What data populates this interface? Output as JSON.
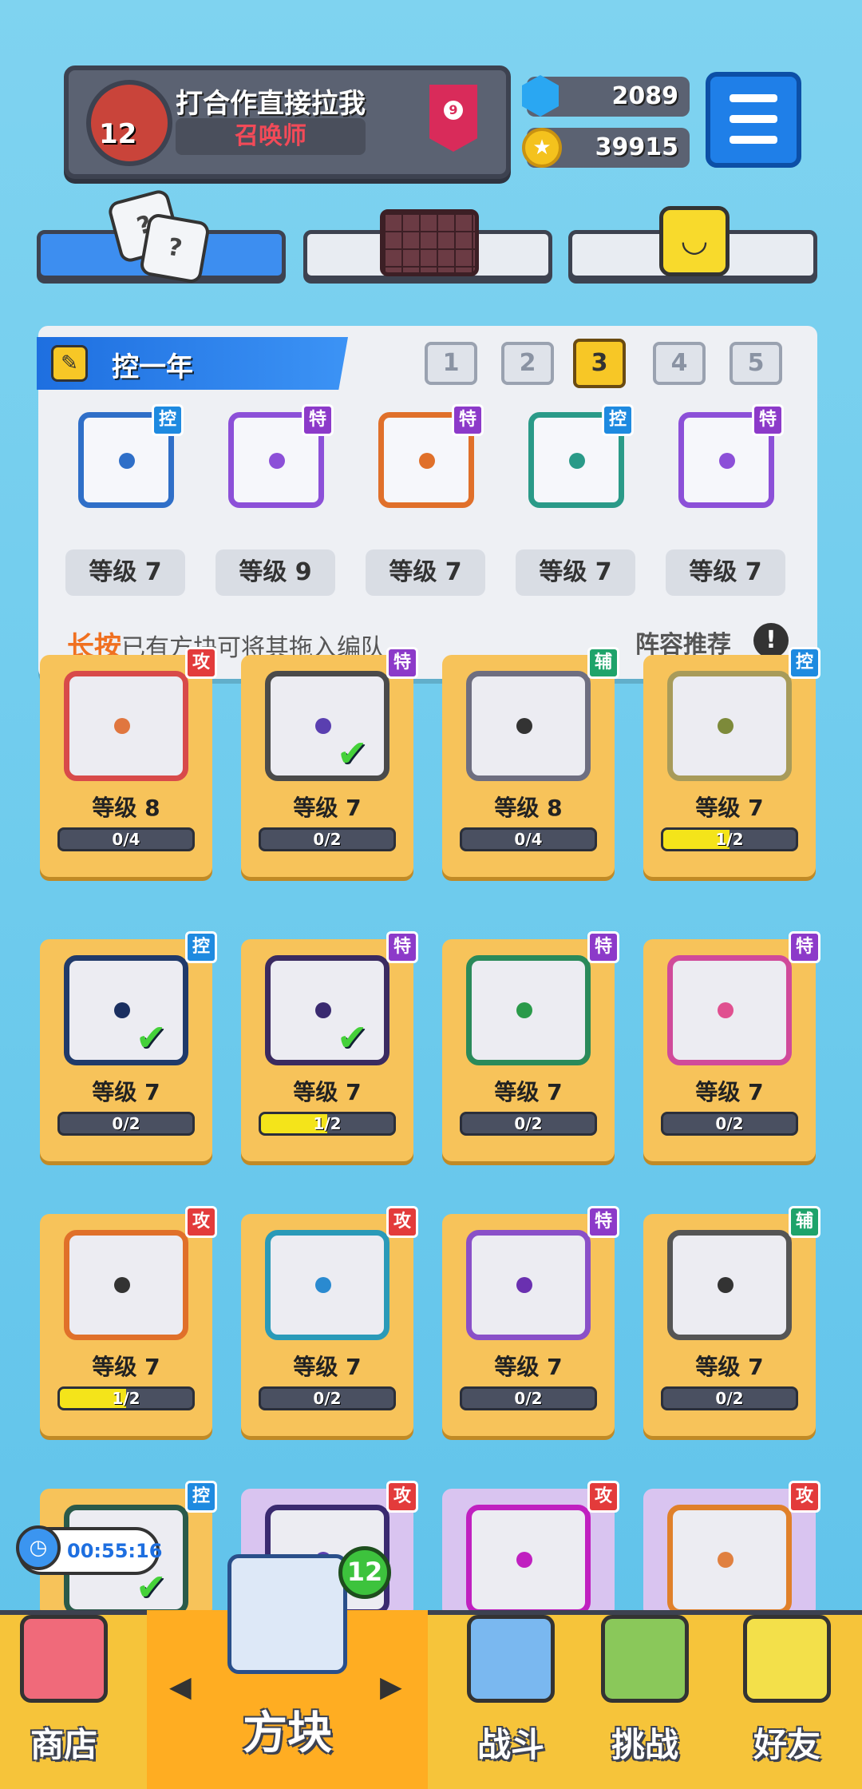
{
  "header": {
    "player_name": "打合作直接拉我",
    "player_title": "召唤师",
    "player_level": "12",
    "rank_badge": "9",
    "gems": "2089",
    "coins": "39915",
    "menu_icon": "hamburger-icon",
    "gem_icon": "gem-icon",
    "coin_icon": "coin-icon"
  },
  "tabs": [
    {
      "icon": "dice-icon",
      "active": true
    },
    {
      "icon": "grid-board-icon",
      "active": false
    },
    {
      "icon": "smiley-block-icon",
      "active": false
    }
  ],
  "deck": {
    "name": "控一年",
    "pages": [
      "1",
      "2",
      "3",
      "4",
      "5"
    ],
    "active_page": "3",
    "cards": [
      {
        "tag": "控",
        "level": "等级 7",
        "color": "#2f6fc8"
      },
      {
        "tag": "特",
        "level": "等级 9",
        "color": "#8c50d8"
      },
      {
        "tag": "特",
        "level": "等级 7",
        "color": "#e0702a"
      },
      {
        "tag": "控",
        "level": "等级 7",
        "color": "#2a9a88"
      },
      {
        "tag": "特",
        "level": "等级 7",
        "color": "#8c50d8"
      }
    ],
    "hint_highlight": "长按",
    "hint_rest": "已有方块可将其拖入编队",
    "recommend_label": "阵容推荐",
    "recommend_icon": "!"
  },
  "collection": [
    {
      "tag": "攻",
      "tagc": "g",
      "level": "等级 8",
      "progress": "0/4",
      "fill": 0,
      "dot": "#e0763f",
      "border": "#d84a4a",
      "check": false
    },
    {
      "tag": "特",
      "tagc": "t",
      "level": "等级 7",
      "progress": "0/2",
      "fill": 0,
      "dot": "#5a3fb0",
      "border": "#4a4a4a",
      "check": true
    },
    {
      "tag": "辅",
      "tagc": "f",
      "level": "等级 8",
      "progress": "0/4",
      "fill": 0,
      "dot": "#333333",
      "border": "#6e6e80",
      "check": false
    },
    {
      "tag": "控",
      "tagc": "k",
      "level": "等级 7",
      "progress": "1/2",
      "fill": 0.5,
      "dot": "#7d8a3a",
      "border": "#a89b5a",
      "check": false
    },
    {
      "tag": "控",
      "tagc": "k",
      "level": "等级 7",
      "progress": "0/2",
      "fill": 0,
      "dot": "#1a2f60",
      "border": "#203a6a",
      "check": true
    },
    {
      "tag": "特",
      "tagc": "t",
      "level": "等级 7",
      "progress": "1/2",
      "fill": 0.5,
      "dot": "#3a2a70",
      "border": "#3a2a60",
      "check": true
    },
    {
      "tag": "特",
      "tagc": "t",
      "level": "等级 7",
      "progress": "0/2",
      "fill": 0,
      "dot": "#2a9a4a",
      "border": "#2a8a5a",
      "check": false
    },
    {
      "tag": "特",
      "tagc": "t",
      "level": "等级 7",
      "progress": "0/2",
      "fill": 0,
      "dot": "#e05090",
      "border": "#d04a9a",
      "check": false
    },
    {
      "tag": "攻",
      "tagc": "g",
      "level": "等级 7",
      "progress": "1/2",
      "fill": 0.5,
      "dot": "#333333",
      "border": "#e0702a",
      "check": false
    },
    {
      "tag": "攻",
      "tagc": "g",
      "level": "等级 7",
      "progress": "0/2",
      "fill": 0,
      "dot": "#2a8ad0",
      "border": "#2a9ab8",
      "check": false
    },
    {
      "tag": "特",
      "tagc": "t",
      "level": "等级 7",
      "progress": "0/2",
      "fill": 0,
      "dot": "#6a30b0",
      "border": "#8a50c8",
      "check": false
    },
    {
      "tag": "辅",
      "tagc": "f",
      "level": "等级 7",
      "progress": "0/2",
      "fill": 0,
      "dot": "#333333",
      "border": "#555555",
      "check": false
    },
    {
      "tag": "控",
      "tagc": "k",
      "level": "",
      "progress": "",
      "fill": 0,
      "dot": "#2a6a4a",
      "border": "#2a5a4a",
      "check": true,
      "partial": true
    },
    {
      "tag": "攻",
      "tagc": "g",
      "level": "",
      "progress": "",
      "fill": 0,
      "dot": "#5a3fb0",
      "border": "#3a2a70",
      "check": false,
      "partial": true,
      "purple": true
    },
    {
      "tag": "攻",
      "tagc": "g",
      "level": "",
      "progress": "",
      "fill": 0,
      "dot": "#c020c0",
      "border": "#c020c0",
      "check": false,
      "partial": true,
      "purple": true
    },
    {
      "tag": "攻",
      "tagc": "g",
      "level": "",
      "progress": "",
      "fill": 0,
      "dot": "#e08040",
      "border": "#e0802a",
      "check": false,
      "partial": true,
      "purple": true
    }
  ],
  "timer": {
    "value": "00:55:16",
    "icon": "clock-icon"
  },
  "nav": {
    "shop": "商店",
    "blocks": "方块",
    "blocks_count": "12",
    "battle": "战斗",
    "challenge": "挑战",
    "friends": "好友",
    "left_arrow": "◀",
    "right_arrow": "▶"
  }
}
